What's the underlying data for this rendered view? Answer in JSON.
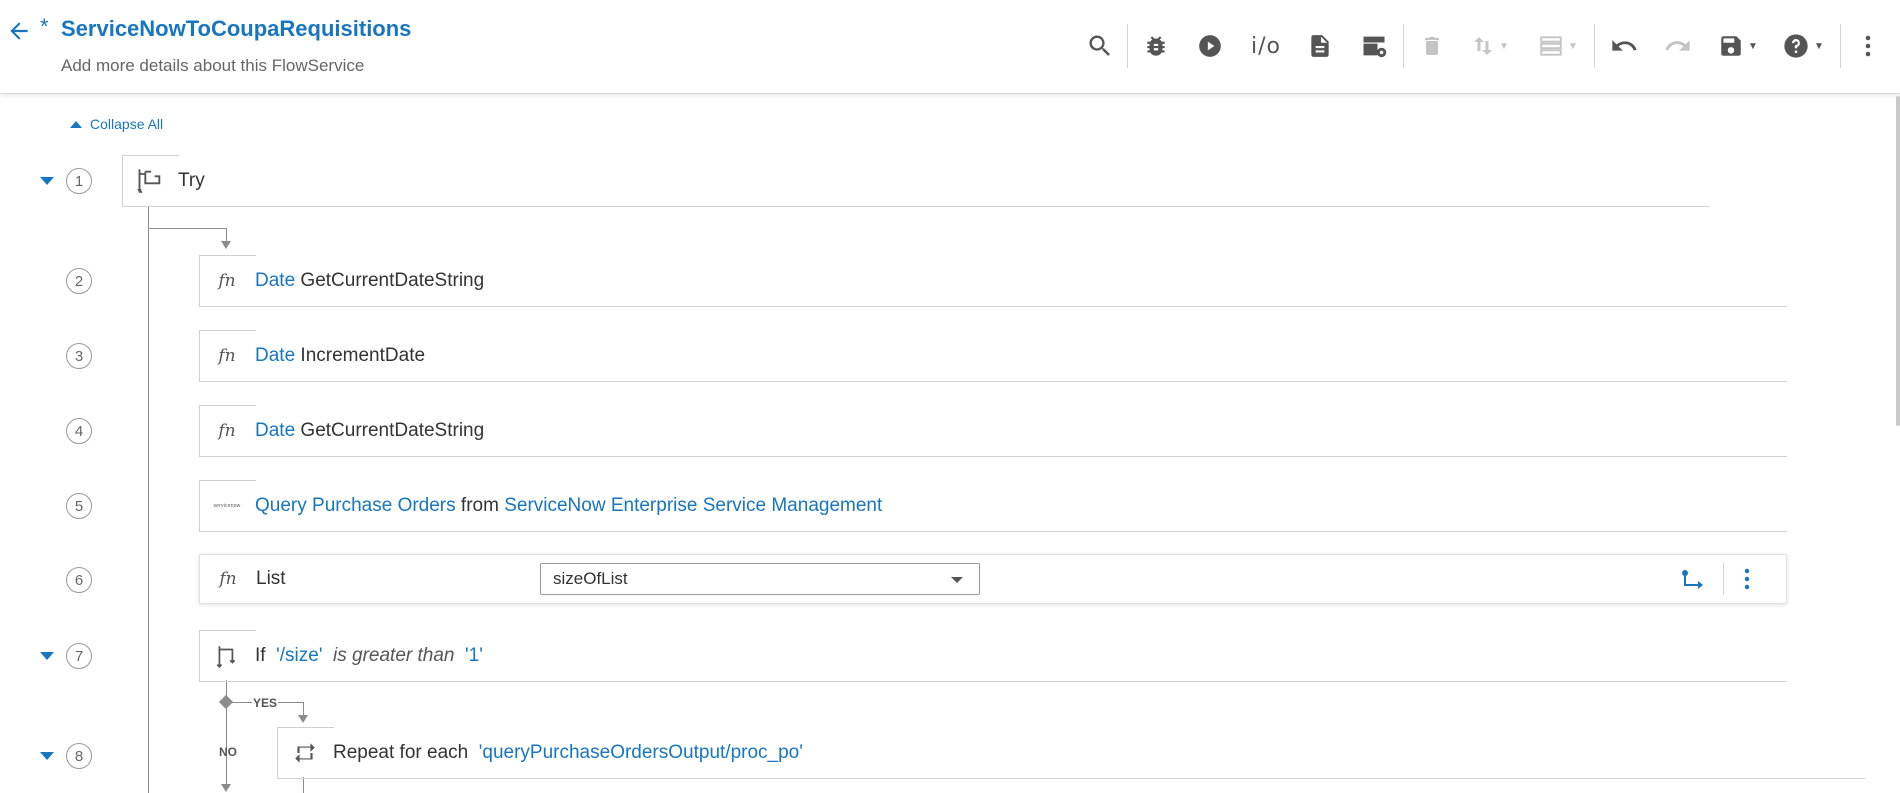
{
  "header": {
    "back_icon": "arrow-left-icon",
    "dirty_marker": "*",
    "title": "ServiceNowToCoupaRequisitions",
    "subtitle": "Add more details about this FlowService",
    "io_label": "i/o"
  },
  "canvas": {
    "collapse_all": "Collapse All"
  },
  "steps": [
    {
      "number": "1",
      "label": "Try"
    },
    {
      "number": "2",
      "category": "Date",
      "operation": "GetCurrentDateString"
    },
    {
      "number": "3",
      "category": "Date",
      "operation": "IncrementDate"
    },
    {
      "number": "4",
      "category": "Date",
      "operation": "GetCurrentDateString"
    },
    {
      "number": "5",
      "operation": "Query Purchase Orders",
      "connector_word": "from",
      "connector": "ServiceNow Enterprise Service Management",
      "logo_text": "servicenow"
    },
    {
      "number": "6",
      "category": "List",
      "selected": "sizeOfList"
    },
    {
      "number": "7",
      "keyword": "If",
      "left": "'/size'",
      "operator": "is greater than",
      "right": "'1'"
    },
    {
      "number": "8",
      "keyword": "Repeat for each",
      "target": "'queryPurchaseOrdersOutput/proc_po'"
    }
  ],
  "branches": {
    "yes": "YES",
    "no": "NO"
  },
  "colors": {
    "accent": "#1776bf",
    "text": "#333333",
    "muted": "#666666",
    "connector": "#8c8c8c"
  }
}
